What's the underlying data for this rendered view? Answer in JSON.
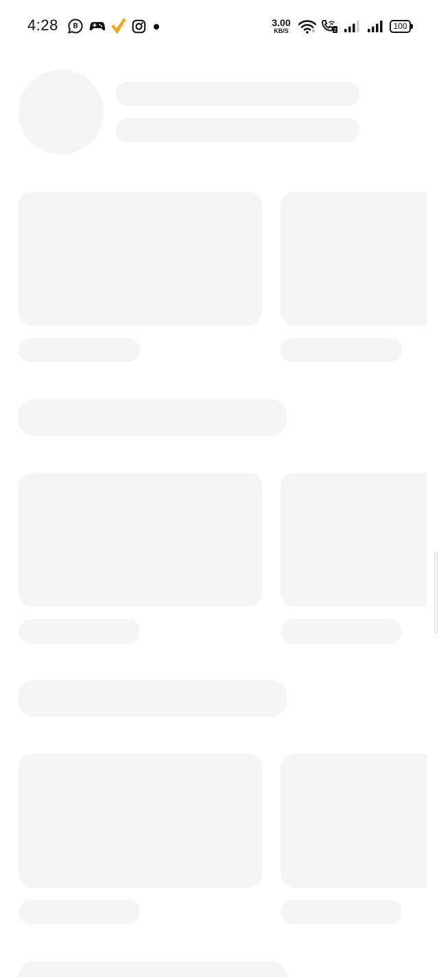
{
  "status_bar": {
    "time": "4:28",
    "network_speed_value": "3.00",
    "network_speed_unit": "KB/S",
    "battery_level": "100",
    "notification_icons": [
      "business-chat-icon",
      "game-controller-icon",
      "checkmark-app-icon",
      "instagram-icon",
      "more-notifications-dot"
    ],
    "system_icons": [
      "wifi-icon",
      "wifi-calling-icon",
      "signal-sim1-icon",
      "signal-sim2-icon",
      "battery-icon"
    ],
    "accent_color": "#f2a51a"
  },
  "loading_skeleton": {
    "state": "loading",
    "placeholder_color": "#f4f4f4",
    "sections": 3
  }
}
